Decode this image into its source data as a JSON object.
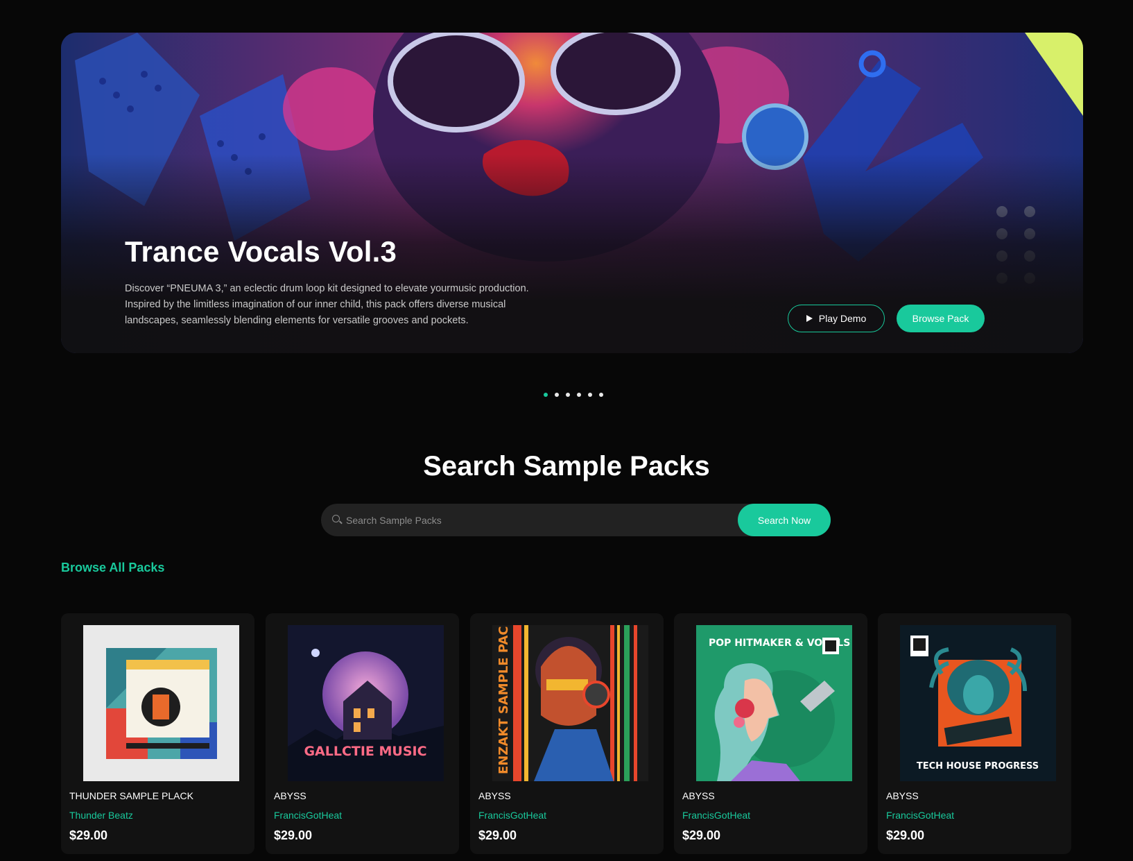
{
  "hero": {
    "title": "Trance Vocals Vol.3",
    "description": "Discover “PNEUMA 3,” an eclectic drum loop kit designed to elevate yourmusic production. Inspired by the limitless imagination of our inner child, this pack offers diverse musical landscapes, seamlessly blending elements for versatile grooves and pockets.",
    "play_label": "Play Demo",
    "browse_label": "Browse Pack"
  },
  "carousel": {
    "slides": 6,
    "active": 1
  },
  "search": {
    "title": "Search Sample Packs",
    "placeholder": "Search Sample Packs",
    "button_label": "Search Now"
  },
  "browse": {
    "heading": "Browse All Packs"
  },
  "cards": [
    {
      "title": "THUNDER SAMPLE PLACK",
      "author": "Thunder Beatz",
      "price": "$29.00",
      "cover_text": ""
    },
    {
      "title": "ABYSS",
      "author": "FrancisGotHeat",
      "price": "$29.00",
      "cover_text": "GALLCTIE MUSIC"
    },
    {
      "title": "ABYSS",
      "author": "FrancisGotHeat",
      "price": "$29.00",
      "cover_text": "ENZAKT SAMPLE PACK"
    },
    {
      "title": "ABYSS",
      "author": "FrancisGotHeat",
      "price": "$29.00",
      "cover_text": "POP HITMAKER & VOCALS"
    },
    {
      "title": "ABYSS",
      "author": "FrancisGotHeat",
      "price": "$29.00",
      "cover_text": "TECH HOUSE PROGRESS"
    }
  ],
  "colors": {
    "accent": "#19c99c",
    "background": "#070707",
    "card": "#121212"
  }
}
